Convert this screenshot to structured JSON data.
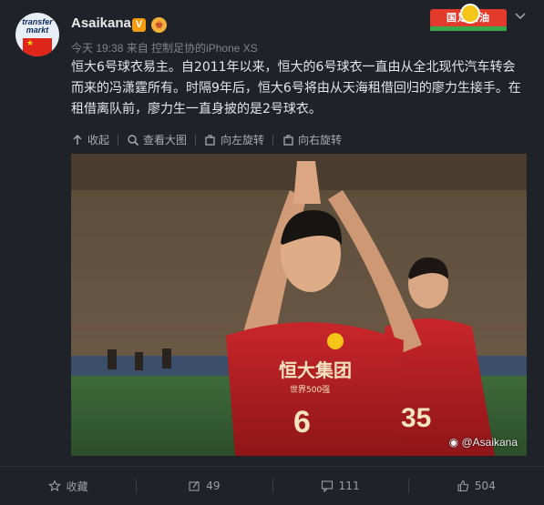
{
  "user": {
    "name": "Asaikana",
    "verified_badge": "V",
    "avatar_logo": "transfer markt",
    "meta_time": "今天 19:38",
    "meta_from": "来自",
    "meta_source": "控制足协的iPhone XS"
  },
  "card_badge": {
    "label": "国足加油"
  },
  "post": {
    "text": "恒大6号球衣易主。自2011年以来，恒大的6号球衣一直由从全北现代汽车转会而来的冯潇霆所有。时隔9年后，恒大6号将由从天海租借回归的廖力生接手。在租借离队前，廖力生一直身披的是2号球衣。"
  },
  "image_actions": {
    "collapse": "收起",
    "view_large": "查看大图",
    "rotate_left": "向左旋转",
    "rotate_right": "向右旋转"
  },
  "photo": {
    "watermark": "@Asaikana",
    "jersey_sponsor": "恒大集团",
    "jersey_sub": "世界500强",
    "player_number_front": "6",
    "player_number_back": "35"
  },
  "footer": {
    "favorite": "收藏",
    "repost_count": "49",
    "comment_count": "111",
    "like_count": "504"
  },
  "colors": {
    "background": "#1f2228",
    "text": "#e3e6ea",
    "muted": "#7f858f",
    "jersey_red": "#c8262a",
    "verified": "#f59c0c"
  }
}
